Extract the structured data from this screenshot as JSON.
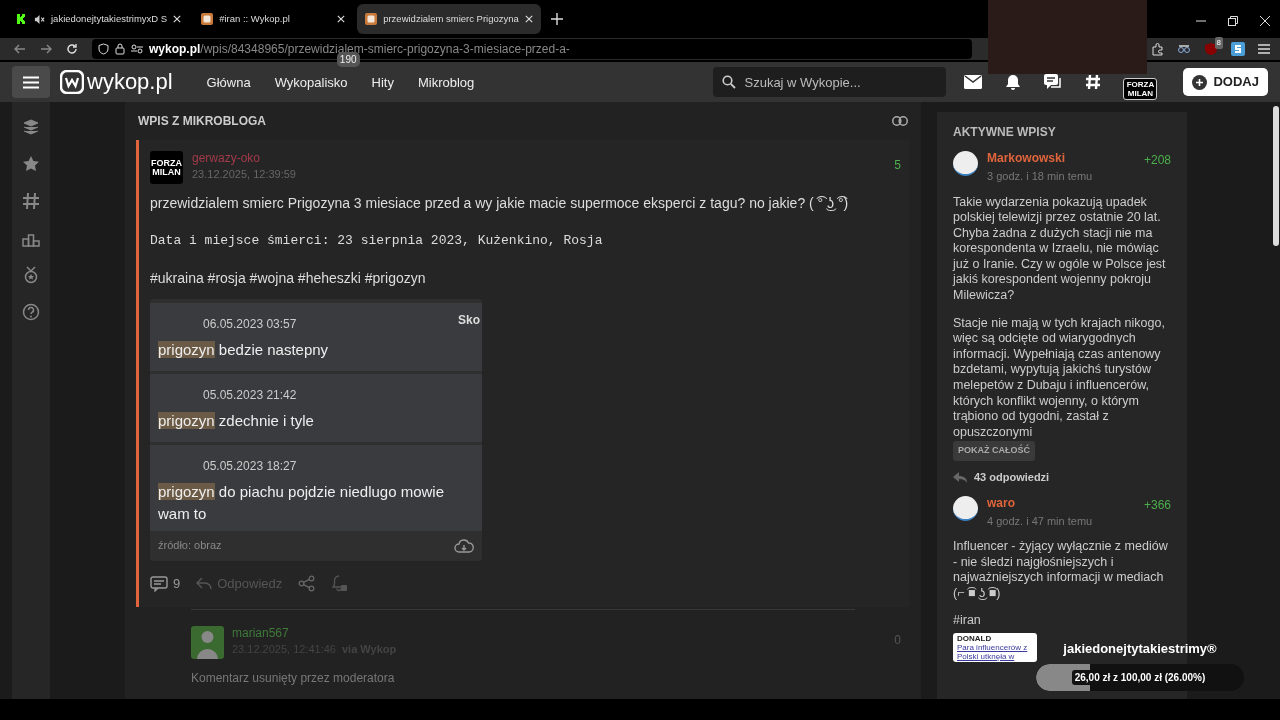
{
  "browser": {
    "tabs": [
      {
        "kind": "kick",
        "title": "jakiedonejtytakiestrimyxD S",
        "muted": true,
        "selected": false
      },
      {
        "kind": "wykop",
        "title": "#iran :: Wykop.pl",
        "muted": false,
        "selected": false
      },
      {
        "kind": "wykop",
        "title": "przewidzialem smierc Prigozyna",
        "muted": false,
        "selected": true
      }
    ],
    "url": {
      "domain": "wykop.pl",
      "path": "/wpis/84348965/przewidzialem-smierc-prigozyna-3-miesiace-przed-a-"
    },
    "extension_badge": "8"
  },
  "site_header": {
    "logo": "wykop.pl",
    "nav": [
      {
        "label": "Główna"
      },
      {
        "label": "Wykopalisko",
        "badge": "190"
      },
      {
        "label": "Hity"
      },
      {
        "label": "Mikroblog"
      }
    ],
    "search": {
      "placeholder": "Szukaj w Wykopie..."
    },
    "avatar_text": "FORZA MILAN",
    "add_button": "DODAJ"
  },
  "page_title": "WPIS Z MIKROBLOGA",
  "post": {
    "avatar_text": "FORZA MILAN",
    "author": "gerwazy-oko",
    "date": "23.12.2025, 12:39:59",
    "score": "5",
    "text": "przewidzialem smierc Prigozyna 3 miesiace przed a wy jakie macie supermoce eksperci z tagu? no jakie? ( ͡° ͜ʖ ͡°)",
    "code_line": "Data i miejsce śmierci: 23 sierpnia 2023, Kużenkino, Rosja",
    "tags": "#ukraina #rosja #wojna #heheszki #prigozyn",
    "image": {
      "corner_text": "Sko",
      "rows": [
        {
          "date": "06.05.2023 03:57",
          "highlight": "prigozyn",
          "text": "bedzie nastepny"
        },
        {
          "date": "05.05.2023 21:42",
          "highlight": "prigozyn",
          "text": "zdechnie i tyle"
        },
        {
          "date": "05.05.2023 18:27",
          "highlight": "prigozyn",
          "text": "do piachu pojdzie niedlugo mowie wam to"
        }
      ],
      "source": "źródło: obraz"
    },
    "comments_count": "9",
    "reply_label": "Odpowiedz"
  },
  "comment": {
    "author": "marian567",
    "date": "23.12.2025, 12:41:46",
    "via": "via Wykop",
    "score": "0",
    "text": "Komentarz usunięty przez moderatora"
  },
  "sidebar": {
    "title": "AKTYWNE WPISY",
    "entries": [
      {
        "author": "Markowowski",
        "time": "3 godz. i 18 min temu",
        "score": "+208",
        "paragraphs": [
          "Takie wydarzenia pokazują upadek polskiej telewizji przez ostatnie 20 lat. Chyba żadna z dużych stacji nie ma korespondenta w Izraelu, nie mówiąc już o Iranie. Czy w ogóle w Polsce jest jakiś korespondent wojenny pokroju Milewicza?",
          "Stacje nie mają w tych krajach nikogo, więc są odcięte od wiarygodnych informacji. Wypełniają czas antenowy bzdetami, wypytują jakichś turystów melepetów z Dubaju i influencerów, których konflikt wojenny, o którym trąbiono od tygodni, zastał z opuszczonymi"
        ],
        "more_button": "POKAŻ CAŁOŚĆ",
        "replies": "43 odpowiedzi"
      },
      {
        "author": "waro",
        "time": "4 godz. i 47 min temu",
        "score": "+366",
        "paragraphs": [
          "Influencer - żyjący wyłącznie z mediów - nie śledzi najgłośniejszych i najważniejszych informacji w mediach (⌐ ͡■ ͜ʖ ͡■)",
          "#iran"
        ],
        "image": {
          "brand": "DONALD",
          "headline": "Para influencerów z Polski utknęła w"
        }
      }
    ]
  },
  "overlay": {
    "title": "jakiedonejtytakiestrimy®",
    "progress_text": "26,00 zł z 100,00 zł (26.00%)",
    "level": 0.26
  }
}
